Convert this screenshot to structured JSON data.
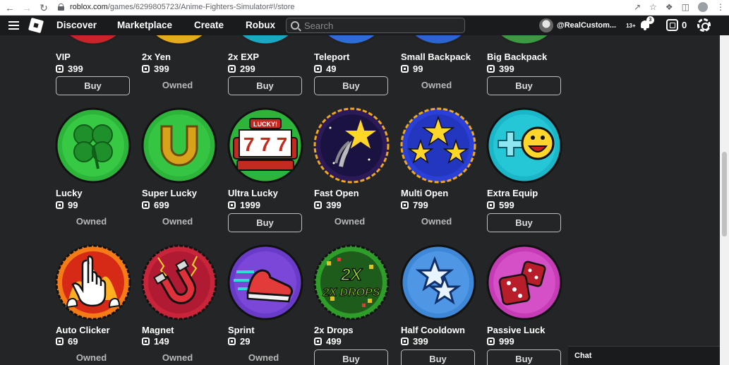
{
  "browser": {
    "url_host": "roblox.com",
    "url_path": "/games/6299805723/Anime-Fighters-Simulator#!/store"
  },
  "nav": {
    "links": [
      "Discover",
      "Marketplace",
      "Create",
      "Robux"
    ],
    "search_placeholder": "Search",
    "username": "@RealCustom...",
    "age": "13+",
    "notification_count": "3",
    "robux_balance": "0"
  },
  "store": {
    "rows": [
      [
        {
          "name": "VIP",
          "price": "399",
          "status": "Buy"
        },
        {
          "name": "2x Yen",
          "price": "399",
          "status": "Owned"
        },
        {
          "name": "2x EXP",
          "price": "299",
          "status": "Buy"
        },
        {
          "name": "Teleport",
          "price": "49",
          "status": "Buy"
        },
        {
          "name": "Small Backpack",
          "price": "99",
          "status": "Owned"
        },
        {
          "name": "Big Backpack",
          "price": "399",
          "status": "Buy"
        }
      ],
      [
        {
          "name": "Lucky",
          "price": "99",
          "status": "Owned",
          "icon": "clover-icon"
        },
        {
          "name": "Super Lucky",
          "price": "699",
          "status": "Owned",
          "icon": "horseshoe-icon"
        },
        {
          "name": "Ultra Lucky",
          "price": "1999",
          "status": "Buy",
          "icon": "slot-machine-icon"
        },
        {
          "name": "Fast Open",
          "price": "399",
          "status": "Owned",
          "icon": "shooting-star-icon"
        },
        {
          "name": "Multi Open",
          "price": "799",
          "status": "Owned",
          "icon": "stars-icon"
        },
        {
          "name": "Extra Equip",
          "price": "599",
          "status": "Buy",
          "icon": "plus-smiley-icon"
        }
      ],
      [
        {
          "name": "Auto Clicker",
          "price": "69",
          "status": "Owned",
          "icon": "pointer-hand-icon"
        },
        {
          "name": "Magnet",
          "price": "149",
          "status": "Owned",
          "icon": "magnet-icon"
        },
        {
          "name": "Sprint",
          "price": "29",
          "status": "Owned",
          "icon": "sneaker-icon"
        },
        {
          "name": "2x Drops",
          "price": "499",
          "status": "Buy",
          "icon": "2x-drops-icon",
          "icon_text": "2X DROPS"
        },
        {
          "name": "Half Cooldown",
          "price": "399",
          "status": "Buy",
          "icon": "stars-outline-icon"
        },
        {
          "name": "Passive Luck",
          "price": "999",
          "status": "Buy",
          "icon": "dice-icon"
        }
      ]
    ],
    "slot_label": "LUCKY!"
  },
  "chat": {
    "label": "Chat"
  },
  "colors": {
    "nav_bg": "#191b1d",
    "page_bg": "#232527",
    "clover_green": "#2cb53a",
    "horseshoe_gold": "#d9a21b",
    "slot_red": "#c32a20",
    "night_purple": "#2b1a57",
    "royal_blue": "#2a3fd6",
    "teal": "#1bb7c8",
    "flame_orange": "#f47b16",
    "magnet_red": "#c8243a",
    "sprint_purple": "#6a3bc9",
    "drops_green": "#2f9d2a",
    "sky_blue": "#3f88d8",
    "magenta": "#c63cb6"
  }
}
